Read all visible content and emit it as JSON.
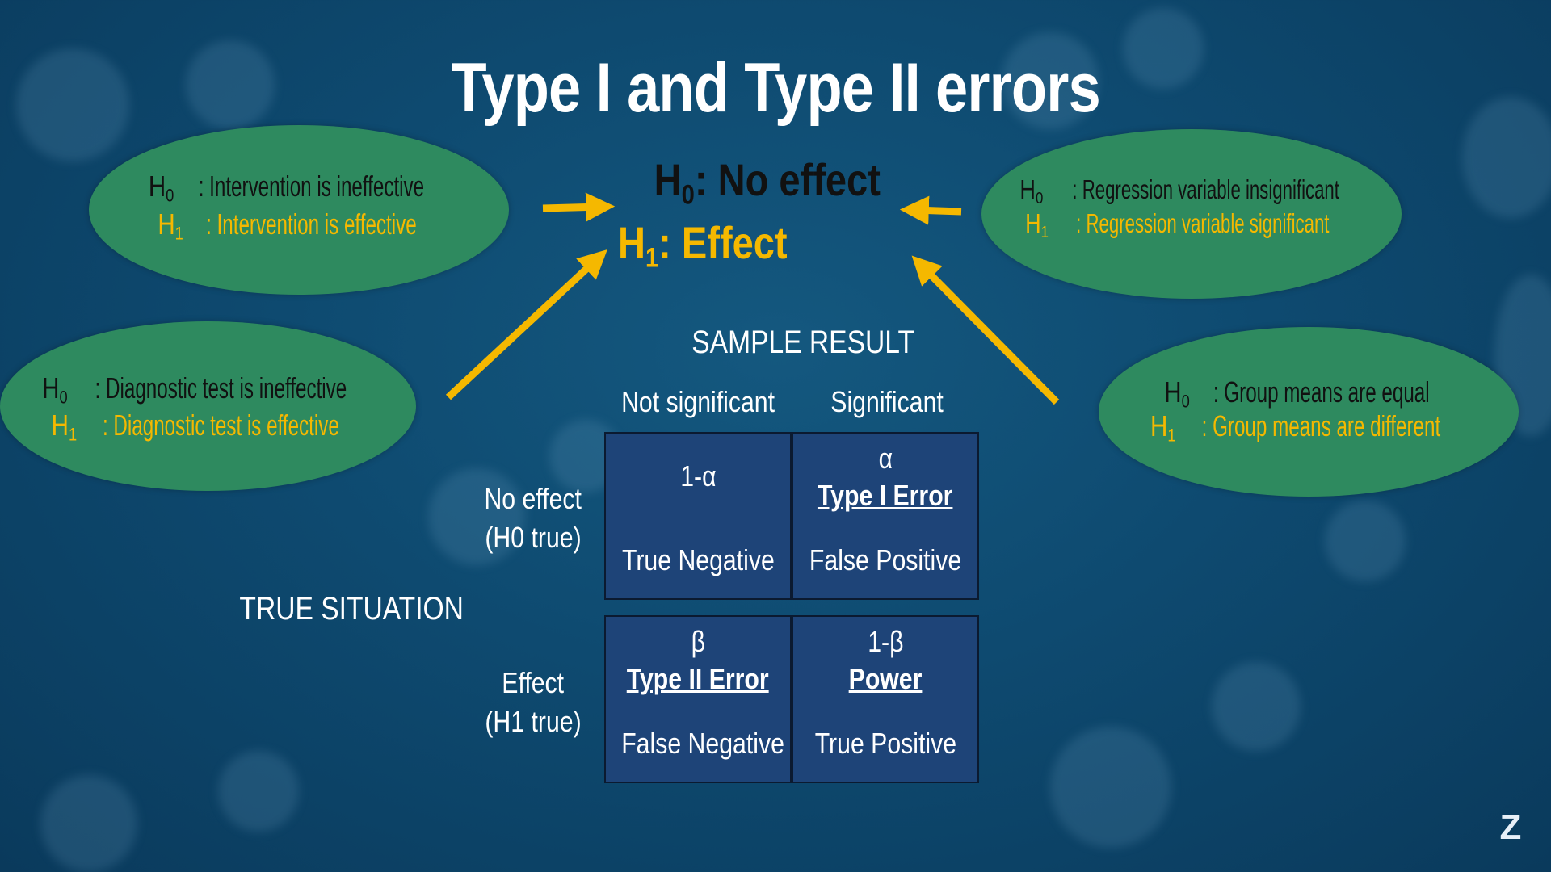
{
  "title": "Type I and Type II errors",
  "center": {
    "h0_prefix": "H",
    "h0_sub": "0",
    "h0_text": ": No effect",
    "h1_prefix": "H",
    "h1_sub": "1",
    "h1_text": ": Effect"
  },
  "ellipses": [
    {
      "h0_text": ": Intervention is ineffective",
      "h1_text": ": Intervention is effective"
    },
    {
      "h0_text": ": Regression variable insignificant",
      "h1_text": ": Regression variable significant"
    },
    {
      "h0_text": ": Diagnostic test is ineffective",
      "h1_text": ": Diagnostic test is effective"
    },
    {
      "h0_text": ": Group means are equal",
      "h1_text": ": Group means are different"
    }
  ],
  "sample_result": "SAMPLE RESULT",
  "col_headers": [
    "Not significant",
    "Significant"
  ],
  "true_situation": "TRUE SITUATION",
  "row_headers": [
    {
      "line1": "No effect",
      "line2": "(H0 true)"
    },
    {
      "line1": "Effect",
      "line2": "(H1 true)"
    }
  ],
  "cells": {
    "tn": {
      "value": "1-α",
      "name": "",
      "label": "True Negative"
    },
    "fp": {
      "value": "α",
      "name": "Type I Error",
      "label": "False Positive"
    },
    "fn": {
      "value": "β",
      "name": "Type II Error",
      "label": "False Negative"
    },
    "tp": {
      "value": "1-β",
      "name": "Power",
      "label": "True Positive"
    }
  },
  "colors": {
    "accent": "#f5b800",
    "ellipse": "#2e8a5f",
    "cell": "#1e4478"
  },
  "logo": "Z"
}
